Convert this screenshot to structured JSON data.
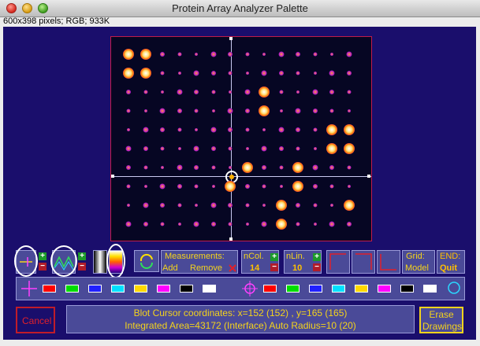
{
  "window": {
    "title": "Protein Array Analyzer Palette"
  },
  "image_info": "600x398 pixels; RGB; 933K",
  "toolbar": {
    "measurements_label": "Measurements:",
    "add_label": "Add",
    "remove_label": "Remove",
    "ncol_label": "nCol.",
    "ncol_value": "14",
    "nlin_label": "nLin.",
    "nlin_value": "10",
    "grid_label": "Grid:",
    "model_label": "Model",
    "end_label": "END:",
    "quit_label": "Quit"
  },
  "swatches_left": [
    "#ff0000",
    "#00dd00",
    "#2020ff",
    "#00e0ff",
    "#ffd800",
    "#ff00ff",
    "#000000",
    "#ffffff"
  ],
  "swatches_right": [
    "#ff0000",
    "#00dd00",
    "#2020ff",
    "#00e0ff",
    "#ffd800",
    "#ff00ff",
    "#000000",
    "#ffffff"
  ],
  "status": {
    "cancel_label": "Cancel",
    "line1": "Blot Cursor coordinates: x=152 (152) , y=165 (165)",
    "line2": "Integrated Area=43172 (Interface) Auto Radius=10 (20)",
    "erase_label": "Erase Drawings"
  },
  "colors": {
    "accent": "#f4d31c",
    "panel_bg": "#1a0e6c",
    "tool_bg": "#4a4a98"
  }
}
